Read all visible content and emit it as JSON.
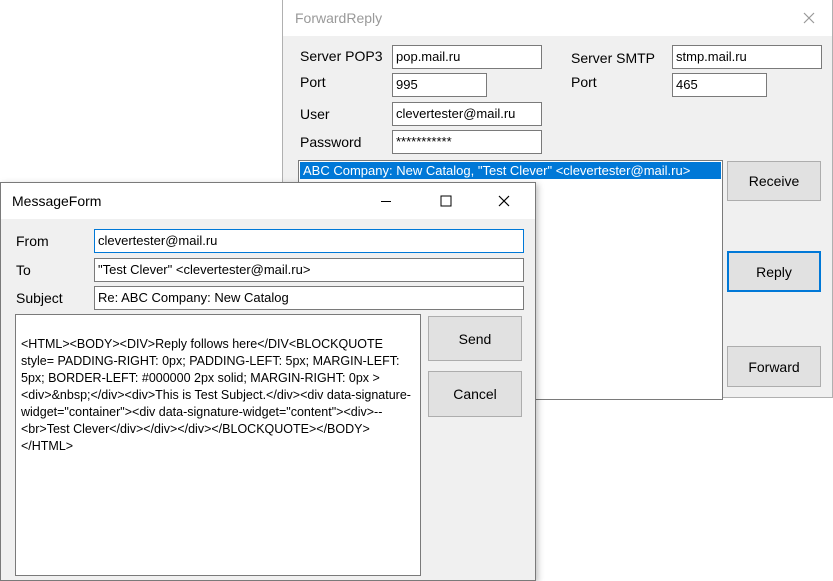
{
  "forward_reply": {
    "title": "ForwardReply",
    "server_pop3_label": "Server POP3",
    "server_pop3_value": "pop.mail.ru",
    "server_smtp_label": "Server SMTP",
    "server_smtp_value": "stmp.mail.ru",
    "port_label_pop": "Port",
    "port_pop_value": "995",
    "port_label_smtp": "Port",
    "port_smtp_value": "465",
    "user_label": "User",
    "user_value": "clevertester@mail.ru",
    "password_label": "Password",
    "password_value": "***********",
    "messages": [
      "ABC Company: New Catalog, \"Test Clever\" <clevertester@mail.ru>"
    ],
    "receive_label": "Receive",
    "reply_label": "Reply",
    "forward_label": "Forward",
    "icons": {
      "close": "close-icon"
    }
  },
  "message_form": {
    "title": "MessageForm",
    "from_label": "From",
    "from_value": "clevertester@mail.ru",
    "to_label": "To",
    "to_value": "\"Test Clever\" <clevertester@mail.ru>",
    "subject_label": "Subject",
    "subject_value": "Re: ABC Company: New Catalog",
    "body": "<HTML><BODY><DIV>Reply follows here</DIV<BLOCKQUOTE style= PADDING-RIGHT: 0px; PADDING-LEFT: 5px; MARGIN-LEFT: 5px; BORDER-LEFT: #000000 2px solid; MARGIN-RIGHT: 0px ><div>&nbsp;</div><div>This is Test Subject.</div><div data-signature-widget=\"container\"><div data-signature-widget=\"content\"><div>--<br>Test Clever</div></div></div></BLOCKQUOTE></BODY></HTML>",
    "send_label": "Send",
    "cancel_label": "Cancel",
    "icons": {
      "minimize": "minimize-icon",
      "maximize": "maximize-icon",
      "close": "close-icon"
    }
  },
  "colors": {
    "selection": "#0078d7",
    "window_bg": "#f0f0f0",
    "button_bg": "#e1e1e1"
  }
}
